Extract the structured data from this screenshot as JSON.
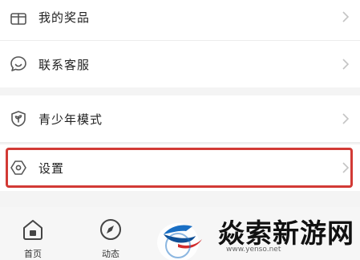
{
  "menu": {
    "items": [
      {
        "label": "我的奖品",
        "icon": "gift-icon"
      },
      {
        "label": "联系客服",
        "icon": "chat-icon"
      },
      {
        "label": "青少年模式",
        "icon": "shield-leaf-icon"
      },
      {
        "label": "设置",
        "icon": "settings-hexagon-icon"
      }
    ],
    "chevron_icon": "chevron-right-icon"
  },
  "tabbar": {
    "tabs": [
      {
        "label": "首页",
        "icon": "home-icon"
      },
      {
        "label": "动态",
        "icon": "compass-icon"
      }
    ]
  },
  "watermark": {
    "text": "焱索新游网",
    "url": "www.yenso.net"
  },
  "colors": {
    "highlight": "#d23a35",
    "icon_stroke": "#555555",
    "watermark_blue": "#1a6fc4",
    "watermark_red": "#d22c2c"
  }
}
